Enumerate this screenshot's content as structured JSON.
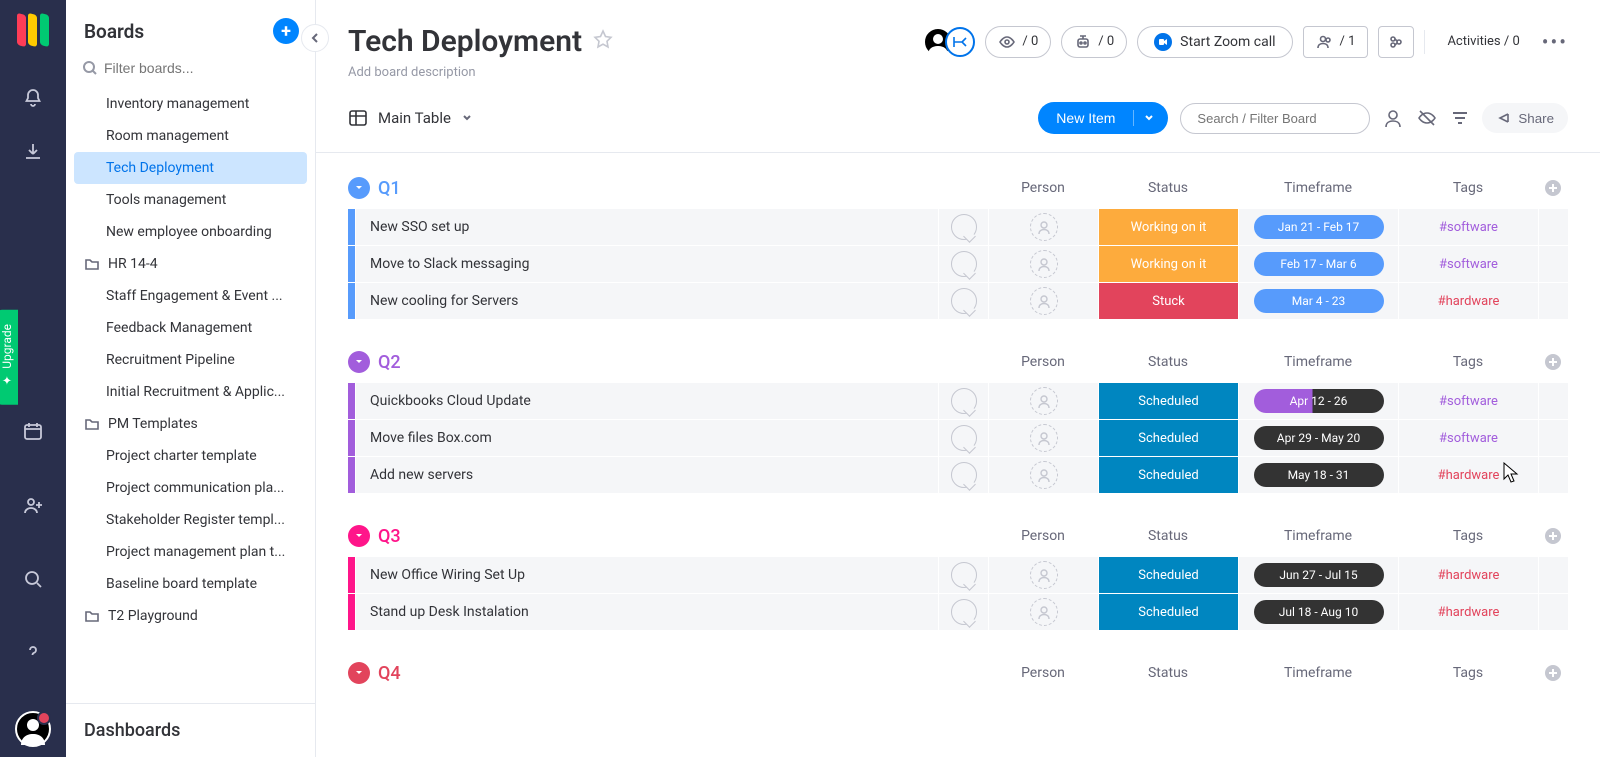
{
  "sidebar": {
    "title": "Boards",
    "search_placeholder": "Filter boards...",
    "dashboards_label": "Dashboards",
    "items": [
      {
        "type": "board",
        "label": "Inventory management"
      },
      {
        "type": "board",
        "label": "Room management"
      },
      {
        "type": "board",
        "label": "Tech Deployment",
        "active": true
      },
      {
        "type": "board",
        "label": "Tools management"
      },
      {
        "type": "board",
        "label": "New employee onboarding"
      },
      {
        "type": "folder",
        "label": "HR 14-4"
      },
      {
        "type": "board",
        "label": "Staff Engagement & Event ..."
      },
      {
        "type": "board",
        "label": "Feedback Management"
      },
      {
        "type": "board",
        "label": "Recruitment Pipeline"
      },
      {
        "type": "board",
        "label": "Initial Recruitment & Applic..."
      },
      {
        "type": "folder",
        "label": "PM Templates"
      },
      {
        "type": "board",
        "label": "Project charter template"
      },
      {
        "type": "board",
        "label": "Project communication pla..."
      },
      {
        "type": "board",
        "label": "Stakeholder Register templ..."
      },
      {
        "type": "board",
        "label": "Project management plan t..."
      },
      {
        "type": "board",
        "label": "Baseline board template"
      },
      {
        "type": "folder",
        "label": "T2 Playground"
      }
    ]
  },
  "header": {
    "board_title": "Tech Deployment",
    "description_placeholder": "Add board description",
    "eye_count": "/ 0",
    "bot_count": "/ 0",
    "zoom_label": "Start Zoom call",
    "members_count": "/ 1",
    "activities_label": "Activities / 0"
  },
  "toolbar": {
    "view_label": "Main Table",
    "new_item_label": "New Item",
    "search_placeholder": "Search / Filter Board",
    "share_label": "Share"
  },
  "upgrade_label": "Upgrade",
  "columns": {
    "person": "Person",
    "status": "Status",
    "timeframe": "Timeframe",
    "tags": "Tags"
  },
  "tag_colors": {
    "software": "#a25ddc",
    "hardware": "#e2445c"
  },
  "groups": [
    {
      "name": "Q1",
      "color": "#579bfc",
      "rows": [
        {
          "name": "New SSO set up",
          "status": "Working on it",
          "status_color": "#fdab3d",
          "timeframe": "Jan 21 - Feb 17",
          "tf_bg": "#579bfc",
          "tf_fill": 0,
          "tag": "#software",
          "tag_type": "software"
        },
        {
          "name": "Move to Slack messaging",
          "status": "Working on it",
          "status_color": "#fdab3d",
          "timeframe": "Feb 17 - Mar 6",
          "tf_bg": "#579bfc",
          "tf_fill": 0,
          "tag": "#software",
          "tag_type": "software"
        },
        {
          "name": "New cooling for Servers",
          "status": "Stuck",
          "status_color": "#e2445c",
          "timeframe": "Mar 4 - 23",
          "tf_bg": "#579bfc",
          "tf_fill": 0,
          "tag": "#hardware",
          "tag_type": "hardware"
        }
      ]
    },
    {
      "name": "Q2",
      "color": "#a25ddc",
      "rows": [
        {
          "name": "Quickbooks Cloud Update",
          "status": "Scheduled",
          "status_color": "#0086c0",
          "timeframe": "Apr 12 - 26",
          "tf_bg": "#333333",
          "tf_overlay": "#a25ddc",
          "tf_fill": 0.45,
          "tag": "#software",
          "tag_type": "software"
        },
        {
          "name": "Move files Box.com",
          "status": "Scheduled",
          "status_color": "#0086c0",
          "timeframe": "Apr 29 - May 20",
          "tf_bg": "#333333",
          "tf_fill": 0,
          "tag": "#software",
          "tag_type": "software"
        },
        {
          "name": "Add new servers",
          "status": "Scheduled",
          "status_color": "#0086c0",
          "timeframe": "May 18 - 31",
          "tf_bg": "#333333",
          "tf_fill": 0,
          "tag": "#hardware",
          "tag_type": "hardware"
        }
      ]
    },
    {
      "name": "Q3",
      "color": "#ff158a",
      "rows": [
        {
          "name": "New Office Wiring Set Up",
          "status": "Scheduled",
          "status_color": "#0086c0",
          "timeframe": "Jun 27 - Jul 15",
          "tf_bg": "#333333",
          "tf_fill": 0,
          "tag": "#hardware",
          "tag_type": "hardware"
        },
        {
          "name": "Stand up Desk Instalation",
          "status": "Scheduled",
          "status_color": "#0086c0",
          "timeframe": "Jul 18 - Aug 10",
          "tf_bg": "#333333",
          "tf_fill": 0,
          "tag": "#hardware",
          "tag_type": "hardware"
        }
      ]
    },
    {
      "name": "Q4",
      "color": "#e2445c",
      "rows": []
    }
  ]
}
